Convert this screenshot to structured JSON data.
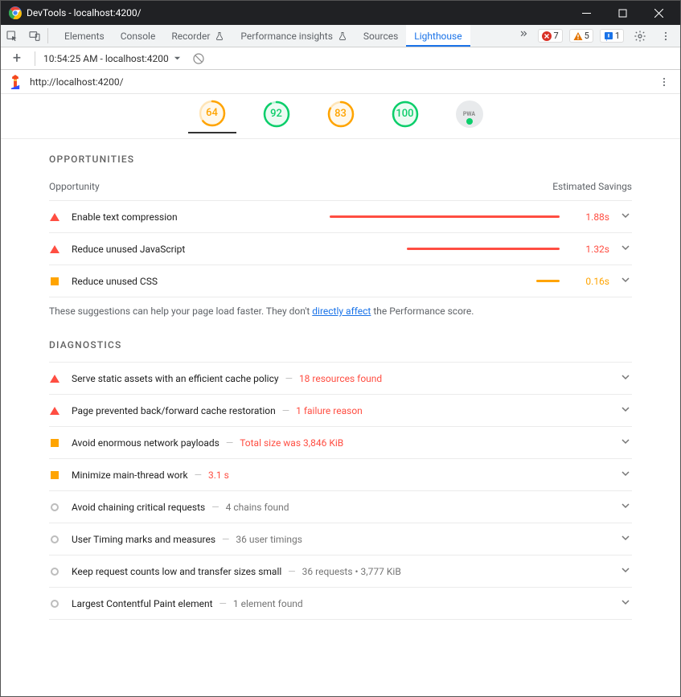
{
  "window": {
    "title": "DevTools - localhost:4200/"
  },
  "tabs": {
    "items": [
      "Elements",
      "Console",
      "Recorder",
      "Performance insights",
      "Sources",
      "Lighthouse"
    ],
    "active_index": 5
  },
  "issues": {
    "errors": "7",
    "warnings": "5",
    "info": "1"
  },
  "toolbar": {
    "run_label": "10:54:25 AM - localhost:4200"
  },
  "urlbar": {
    "url": "http://localhost:4200/"
  },
  "gauges": [
    {
      "score": "64",
      "color": "#ffa400",
      "pct": 64,
      "selected": true
    },
    {
      "score": "92",
      "color": "#0cce6b",
      "pct": 92,
      "selected": false
    },
    {
      "score": "83",
      "color": "#ffa400",
      "pct": 83,
      "selected": false
    },
    {
      "score": "100",
      "color": "#0cce6b",
      "pct": 100,
      "selected": false
    }
  ],
  "pwa_label": "PWA",
  "opportunities": {
    "title": "OPPORTUNITIES",
    "col_label": "Opportunity",
    "col_savings": "Estimated Savings",
    "items": [
      {
        "icon": "tri",
        "title": "Enable text compression",
        "bar_pct": 62,
        "bar_color": "red",
        "saving": "1.88s",
        "saving_color": "red"
      },
      {
        "icon": "tri",
        "title": "Reduce unused JavaScript",
        "bar_pct": 42,
        "bar_color": "red",
        "saving": "1.32s",
        "saving_color": "red"
      },
      {
        "icon": "sq",
        "title": "Reduce unused CSS",
        "bar_pct": 6,
        "bar_color": "orange",
        "saving": "0.16s",
        "saving_color": "orange"
      }
    ],
    "note_pre": "These suggestions can help your page load faster. They don't ",
    "note_link": "directly affect",
    "note_post": " the Performance score."
  },
  "diagnostics": {
    "title": "DIAGNOSTICS",
    "items": [
      {
        "icon": "tri",
        "title": "Serve static assets with an efficient cache policy",
        "sub": "18 resources found",
        "sub_color": "red"
      },
      {
        "icon": "tri",
        "title": "Page prevented back/forward cache restoration",
        "sub": "1 failure reason",
        "sub_color": "red"
      },
      {
        "icon": "sq",
        "title": "Avoid enormous network payloads",
        "sub": "Total size was 3,846 KiB",
        "sub_color": "red"
      },
      {
        "icon": "sq",
        "title": "Minimize main-thread work",
        "sub": "3.1 s",
        "sub_color": "red"
      },
      {
        "icon": "circ",
        "title": "Avoid chaining critical requests",
        "sub": "4 chains found",
        "sub_color": "gray"
      },
      {
        "icon": "circ",
        "title": "User Timing marks and measures",
        "sub": "36 user timings",
        "sub_color": "gray"
      },
      {
        "icon": "circ",
        "title": "Keep request counts low and transfer sizes small",
        "sub": "36 requests • 3,777 KiB",
        "sub_color": "gray"
      },
      {
        "icon": "circ",
        "title": "Largest Contentful Paint element",
        "sub": "1 element found",
        "sub_color": "gray"
      }
    ]
  }
}
